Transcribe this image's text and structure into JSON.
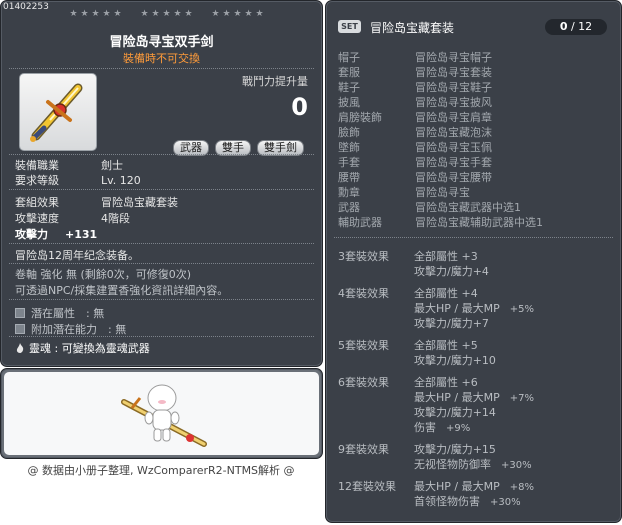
{
  "item": {
    "id": "01402253",
    "title": "冒险岛寻宝双手剑",
    "subtitle": "裝備時不可交換",
    "power_label": "戰鬥力提升量",
    "power_value": "0",
    "tags": [
      "武器",
      "雙手",
      "雙手劍"
    ],
    "stats": [
      {
        "k": "裝備職業",
        "v": "劍士"
      },
      {
        "k": "要求等級",
        "v": "Lv. 120"
      }
    ],
    "set_effect": {
      "k": "套組效果",
      "v": "冒险岛宝藏套装"
    },
    "attack_speed": {
      "k": "攻擊速度",
      "v": "4階段"
    },
    "attack": {
      "k": "攻擊力",
      "v": "+131"
    },
    "description": "冒险岛12周年纪念装备。",
    "scroll_line": "卷軸 強化 無 (剩餘0次，可修復0次)",
    "npc_line": "可透過NPC/採集建置香強化資訊詳細內容。",
    "potential": "潛在屬性　: 無",
    "bonus_potential": "附加潛在能力　: 無",
    "soul": "靈魂 : 可變換為靈魂武器"
  },
  "footer": "@ 数据由小册子整理, WzComparerR2-NTMS解析 @",
  "set": {
    "badge": "SET",
    "name": "冒险岛宝藏套装",
    "count_owned": "0",
    "count_total": "12",
    "pieces": [
      {
        "k": "帽子",
        "v": "冒险岛寻宝帽子"
      },
      {
        "k": "套服",
        "v": "冒险岛寻宝套装"
      },
      {
        "k": "鞋子",
        "v": "冒险岛寻宝鞋子"
      },
      {
        "k": "披風",
        "v": "冒险岛寻宝披风"
      },
      {
        "k": "肩膀裝飾",
        "v": "冒险岛寻宝肩章"
      },
      {
        "k": "臉飾",
        "v": "冒险岛宝藏泡沫"
      },
      {
        "k": "墜飾",
        "v": "冒险岛寻宝玉佩"
      },
      {
        "k": "手套",
        "v": "冒险岛寻宝手套"
      },
      {
        "k": "腰帶",
        "v": "冒险岛寻宝腰带"
      },
      {
        "k": "勳章",
        "v": "冒险岛寻宝"
      },
      {
        "k": "武器",
        "v": "冒险岛宝藏武器中选1"
      },
      {
        "k": "輔助武器",
        "v": "冒险岛宝藏辅助武器中选1"
      }
    ],
    "effects": [
      {
        "title": "3套裝效果",
        "lines": [
          {
            "text": "全部屬性 +3",
            "pct": ""
          },
          {
            "text": "攻擊力/魔力+4",
            "pct": ""
          }
        ]
      },
      {
        "title": "4套裝效果",
        "lines": [
          {
            "text": "全部屬性 +4",
            "pct": ""
          },
          {
            "text": "最大HP / 最大MP",
            "pct": "+5%"
          },
          {
            "text": "攻擊力/魔力+7",
            "pct": ""
          }
        ]
      },
      {
        "title": "5套裝效果",
        "lines": [
          {
            "text": "全部屬性 +5",
            "pct": ""
          },
          {
            "text": "攻擊力/魔力+10",
            "pct": ""
          }
        ]
      },
      {
        "title": "6套裝效果",
        "lines": [
          {
            "text": "全部屬性 +6",
            "pct": ""
          },
          {
            "text": "最大HP / 最大MP",
            "pct": "+7%"
          },
          {
            "text": "攻擊力/魔力+14",
            "pct": ""
          },
          {
            "text": "伤害",
            "pct": "+9%"
          }
        ]
      },
      {
        "title": "9套裝效果",
        "lines": [
          {
            "text": "攻擊力/魔力+15",
            "pct": ""
          },
          {
            "text": "无视怪物防御率",
            "pct": "+30%"
          }
        ]
      },
      {
        "title": "12套裝效果",
        "lines": [
          {
            "text": "最大HP / 最大MP",
            "pct": "+8%"
          },
          {
            "text": "首领怪物伤害",
            "pct": "+30%"
          }
        ]
      }
    ]
  }
}
